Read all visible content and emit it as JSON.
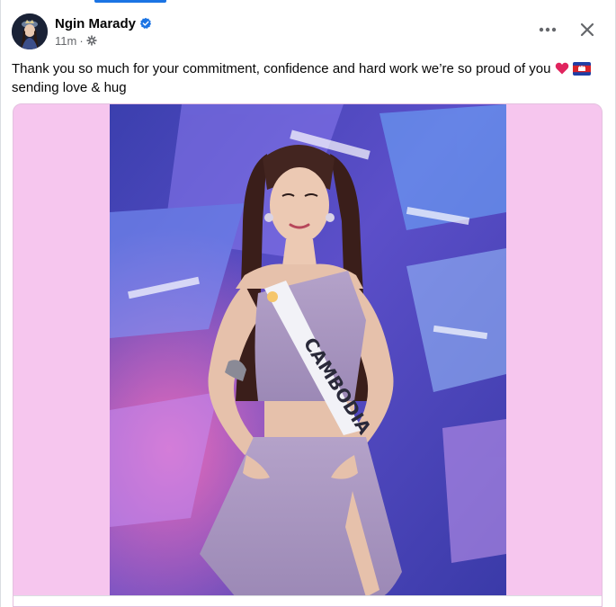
{
  "post": {
    "author_name": "Ngin Marady",
    "timestamp": "11m",
    "separator": "·",
    "audience_icon": "gear-icon",
    "verified_icon": "verified-badge-icon",
    "caption_line1": "Thank you so much for your commitment, confidence and hard work we’re so proud of you",
    "caption_line2": "sending love & hug",
    "caption_emojis": [
      "heart-icon",
      "cambodia-flag-icon"
    ],
    "sash_text": "CAMBODIA"
  },
  "actions": {
    "more_icon": "more-options-icon",
    "close_icon": "close-icon"
  },
  "colors": {
    "link_blue": "#1b74e4",
    "text_primary": "#050505",
    "text_secondary": "#65676b",
    "media_background": "#f6c6ee",
    "heart_red": "#e0245e"
  }
}
